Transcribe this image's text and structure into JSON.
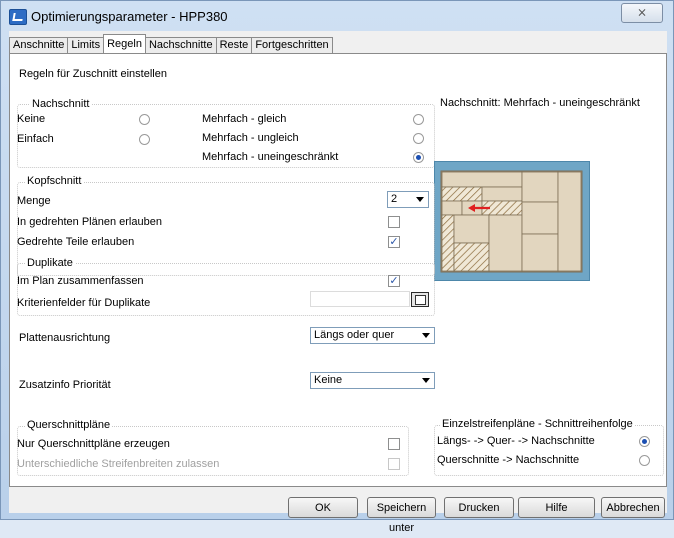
{
  "window": {
    "title": "Optimierungsparameter - HPP380",
    "close_label": "⨯"
  },
  "tabs": [
    {
      "label": "Anschnitte",
      "active": false
    },
    {
      "label": "Limits",
      "active": false
    },
    {
      "label": "Regeln",
      "active": true
    },
    {
      "label": "Nachschnitte",
      "active": false
    },
    {
      "label": "Reste",
      "active": false
    },
    {
      "label": "Fortgeschritten",
      "active": false
    }
  ],
  "panel": {
    "heading": "Regeln für Zuschnitt einstellen"
  },
  "nachschnitt": {
    "title": "Nachschnitt",
    "keine": "Keine",
    "einfach": "Einfach",
    "mehr_gleich": "Mehrfach - gleich",
    "mehr_ungleich": "Mehrfach - ungleich",
    "mehr_uneingeschraenkt": "Mehrfach - uneingeschränkt",
    "selected": "Mehrfach - uneingeschränkt"
  },
  "preview": {
    "caption": "Nachschnitt: Mehrfach - uneingeschränkt"
  },
  "kopfschnitt": {
    "title": "Kopfschnitt",
    "menge_label": "Menge",
    "menge_value": "2",
    "gedrehte_plaene": "In gedrehten Plänen erlauben",
    "gedrehte_plaene_checked": false,
    "gedrehte_teile": "Gedrehte Teile erlauben",
    "gedrehte_teile_checked": true
  },
  "duplikate": {
    "title": "Duplikate",
    "zusammenfassen": "Im Plan zusammenfassen",
    "zusammenfassen_checked": true,
    "kriterien": "Kriterienfelder für Duplikate"
  },
  "plattenausrichtung": {
    "label": "Plattenausrichtung",
    "value": "Längs oder quer"
  },
  "zusatzinfo": {
    "label": "Zusatzinfo Priorität",
    "value": "Keine"
  },
  "querschnitt": {
    "title": "Querschnittpläne",
    "nur": "Nur Querschnittpläne erzeugen",
    "nur_checked": false,
    "unterschiedlich": "Unterschiedliche Streifenbreiten zulassen",
    "unterschiedlich_checked": false
  },
  "einzelstreifen": {
    "title": "Einzelstreifenpläne - Schnittreihenfolge",
    "opt1": "Längs- -> Quer- -> Nachschnitte",
    "opt2": "Querschnitte -> Nachschnitte",
    "selected": "Längs- -> Quer- -> Nachschnitte"
  },
  "buttons": {
    "ok": "OK",
    "save": "Speichern unter",
    "print": "Drucken",
    "help": "Hilfe",
    "cancel": "Abbrechen"
  },
  "colors": {
    "accent": "#1c4fb2",
    "preview_bg": "#6fa6c6",
    "panel_beige": "#e2d6bf",
    "arrow_red": "#e02020"
  }
}
